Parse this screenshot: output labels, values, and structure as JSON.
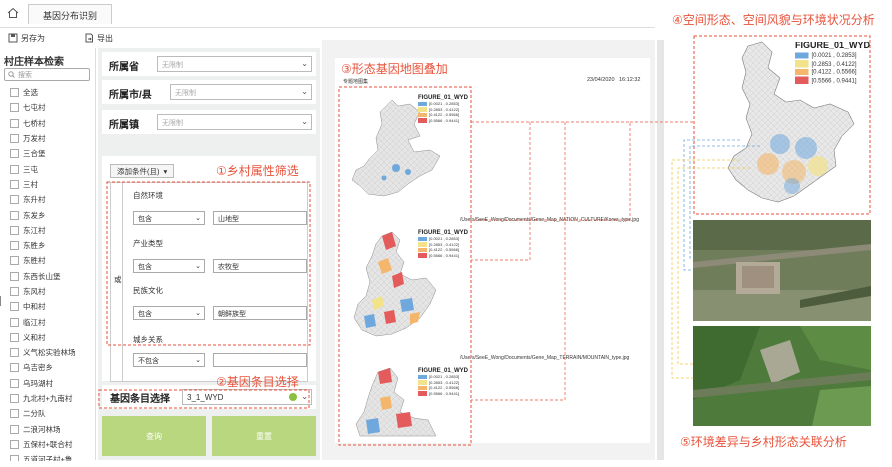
{
  "app": {
    "tab_title": "基因分布识别",
    "save_as": "另存为",
    "export": "导出"
  },
  "left_panel": {
    "title": "村庄样本检索",
    "search_placeholder": "搜索",
    "villages": [
      "全选",
      "七屯村",
      "七桥村",
      "万发村",
      "三合堡",
      "三屯",
      "三村",
      "东升村",
      "东发乡",
      "东江村",
      "东胜乡",
      "东胜村",
      "东西长山堡",
      "东风村",
      "中和村",
      "临江村",
      "义和村",
      "义气松实验林场",
      "乌吉密乡",
      "乌玛湖村",
      "九北村+九南村",
      "二分队",
      "二浪河林场",
      "五保村+联合村",
      "五道河子村+鲁"
    ]
  },
  "filters": {
    "province_label": "所属省",
    "city_label": "所属市/县",
    "town_label": "所属镇",
    "unlimited": "无限制",
    "add_condition": "添加条件(且)",
    "or_label": "或",
    "groups": [
      {
        "title": "自然环境",
        "op": "包含",
        "value": "山地型"
      },
      {
        "title": "产业类型",
        "op": "包含",
        "value": "农牧型"
      },
      {
        "title": "民族文化",
        "op": "包含",
        "value": "朝鲜族型"
      },
      {
        "title": "城乡关系",
        "op": "不包含",
        "value": ""
      }
    ],
    "gene_label": "基因条目选择",
    "gene_value": "3_1_WYD",
    "query_button": "查询",
    "reset_button": "重置"
  },
  "map_page": {
    "header_left": "专题地图集",
    "header_date": "23/04/2020",
    "header_time": "16:12:32",
    "path_1": "/Users/SeeE_Wong/Documents/Gene_Map_NATION_CULTURE/Korea_type.jpg",
    "path_2": "/Users/SeeE_Wong/Documents/Gene_Map_TERRAIN/MOUNTAIN_type.jpg"
  },
  "legend": {
    "title": "FIGURE_01_WYD",
    "items": [
      {
        "label": "[0.0021 , 0.2853]",
        "color": "#6fa8dc"
      },
      {
        "label": "[0.2853 , 0.4122]",
        "color": "#f2e28a"
      },
      {
        "label": "[0.4122 , 0.5566]",
        "color": "#f4b66a"
      },
      {
        "label": "[0.5566 , 0.9441]",
        "color": "#e35b5b"
      }
    ]
  },
  "annotations": {
    "a1": "①乡村属性筛选",
    "a2": "②基因条目选择",
    "a3": "③形态基因地图叠加",
    "a4": "④空间形态、空间风貌与环境状况分析",
    "a5": "⑤环境差异与乡村形态关联分析"
  }
}
